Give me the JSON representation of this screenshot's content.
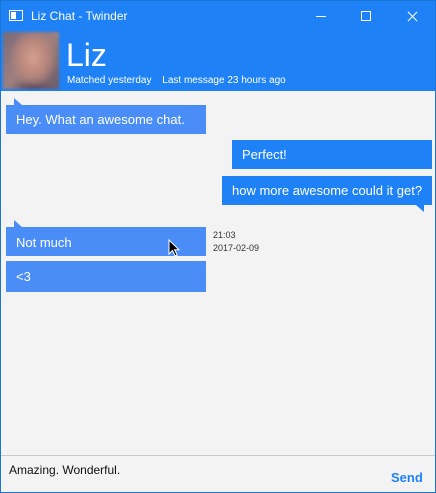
{
  "window": {
    "title": "Liz Chat - Twinder",
    "icons": {
      "app": "app-window-icon",
      "minimize": "minimize-icon",
      "maximize": "maximize-icon",
      "close": "close-icon"
    }
  },
  "profile": {
    "name": "Liz",
    "matched": "Matched yesterday",
    "last_message": "Last message 23 hours ago",
    "avatar": "avatar-photo"
  },
  "messages": [
    {
      "text": "Hey. What an awesome chat.",
      "direction": "incoming"
    },
    {
      "text": "Perfect!",
      "direction": "outgoing"
    },
    {
      "text": "how more awesome could it get?",
      "direction": "outgoing"
    },
    {
      "text": "Not much",
      "direction": "incoming",
      "time": "21:03",
      "date": "2017-02-09"
    },
    {
      "text": "<3",
      "direction": "incoming"
    }
  ],
  "composer": {
    "value": "Amazing. Wonderful.",
    "send_label": "Send"
  },
  "colors": {
    "accent": "#1E82F6",
    "incoming_bubble": "#4B8DF7",
    "background": "#F3F3F3"
  }
}
